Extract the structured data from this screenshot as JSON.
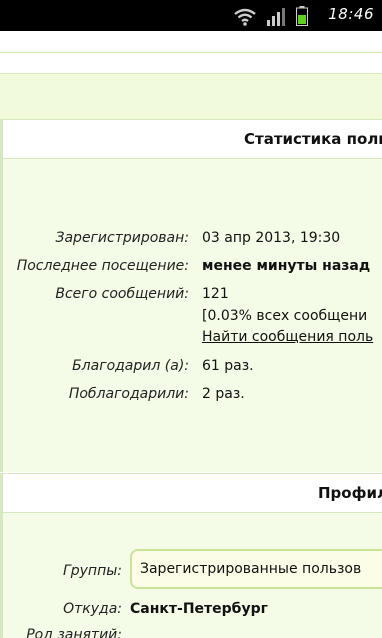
{
  "status_bar": {
    "time": "18:46"
  },
  "stats_section": {
    "title": "Статистика поль",
    "rows": [
      {
        "label": "Зарегистрирован:",
        "value": "03 апр 2013, 19:30"
      },
      {
        "label": "Последнее посещение:",
        "value": "менее минуты назад"
      },
      {
        "label": "Всего сообщений:",
        "value": "121",
        "extra": "[0.03% всех сообщени",
        "link": "Найти сообщения поль"
      },
      {
        "label": "Благодарил (а):",
        "value": "61 раз."
      },
      {
        "label": "Поблагодарили:",
        "value": "2 раз."
      }
    ]
  },
  "profile_section": {
    "title": "Профиль",
    "groups_label": "Группы:",
    "groups_value": "Зарегистрированные пользов",
    "from_label": "Откуда:",
    "from_value": "Санкт-Петербург",
    "interests_label": "Род занятий:"
  }
}
